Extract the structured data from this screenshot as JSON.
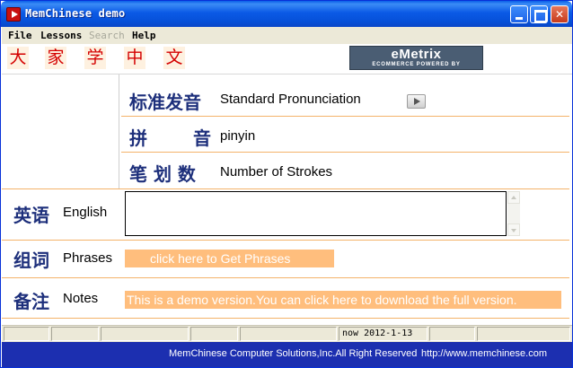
{
  "window": {
    "title": "MemChinese demo"
  },
  "menu": {
    "file": "File",
    "lessons": "Lessons",
    "search": "Search",
    "help": "Help"
  },
  "title_chars": [
    "大",
    "家",
    "学",
    "中",
    "文"
  ],
  "logo": {
    "main": "eMetrix",
    "sub": "ECOMMERCE POWERED BY"
  },
  "fields": {
    "pronunciation": {
      "cn": "标准发音",
      "en": "Standard Pronunciation"
    },
    "pinyin": {
      "cn1": "拼",
      "cn2": "音",
      "en": "pinyin"
    },
    "strokes": {
      "cn": "笔 划 数",
      "en": "Number of Strokes"
    },
    "english": {
      "cn": "英语",
      "en": "English",
      "value": ""
    },
    "phrases": {
      "cn": "组词",
      "en": "Phrases",
      "button": "click here to Get Phrases"
    },
    "notes": {
      "cn": "备注",
      "en": "Notes",
      "text": "This is a demo version.You can click here to download the full version."
    }
  },
  "status": {
    "date": "now  2012-1-13"
  },
  "footer": {
    "company": "MemChinese Computer Solutions,Inc.All Right Reserved",
    "url": "http://www.memchinese.com"
  },
  "colors": {
    "title_bar": "#0650d8",
    "accent_orange": "#ffbe7d",
    "label_blue": "#1d2f7b",
    "tile_red": "#d40000",
    "footer_blue": "#1c2fb0"
  }
}
